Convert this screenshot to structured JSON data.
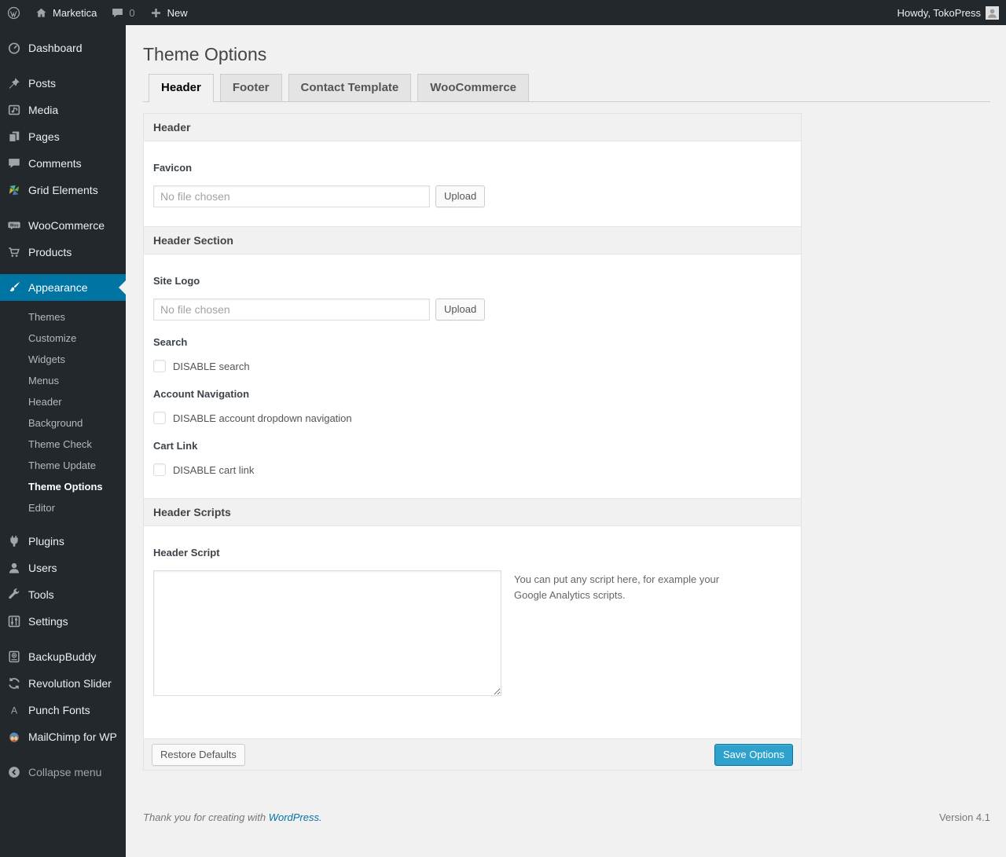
{
  "admin_bar": {
    "site_name": "Marketica",
    "comment_count": "0",
    "new_label": "New",
    "howdy": "Howdy, TokoPress"
  },
  "sidebar": {
    "items": [
      {
        "label": "Dashboard",
        "icon": "dashboard-icon"
      },
      {
        "separator": true
      },
      {
        "label": "Posts",
        "icon": "pin-icon"
      },
      {
        "label": "Media",
        "icon": "media-icon"
      },
      {
        "label": "Pages",
        "icon": "pages-icon"
      },
      {
        "label": "Comments",
        "icon": "comments-icon"
      },
      {
        "label": "Grid Elements",
        "icon": "grid-elements-icon"
      },
      {
        "separator": true
      },
      {
        "label": "WooCommerce",
        "icon": "woocommerce-icon"
      },
      {
        "label": "Products",
        "icon": "cart-icon"
      },
      {
        "separator": true
      },
      {
        "label": "Appearance",
        "icon": "appearance-icon",
        "active": true,
        "submenu": [
          {
            "label": "Themes"
          },
          {
            "label": "Customize"
          },
          {
            "label": "Widgets"
          },
          {
            "label": "Menus"
          },
          {
            "label": "Header"
          },
          {
            "label": "Background"
          },
          {
            "label": "Theme Check"
          },
          {
            "label": "Theme Update"
          },
          {
            "label": "Theme Options",
            "current": true
          },
          {
            "label": "Editor"
          }
        ]
      },
      {
        "label": "Plugins",
        "icon": "plugin-icon"
      },
      {
        "label": "Users",
        "icon": "users-icon"
      },
      {
        "label": "Tools",
        "icon": "tools-icon"
      },
      {
        "label": "Settings",
        "icon": "settings-icon"
      },
      {
        "separator": true
      },
      {
        "label": "BackupBuddy",
        "icon": "backupbuddy-icon"
      },
      {
        "label": "Revolution Slider",
        "icon": "revolution-slider-icon"
      },
      {
        "label": "Punch Fonts",
        "icon": "punch-fonts-icon"
      },
      {
        "label": "MailChimp for WP",
        "icon": "mailchimp-icon"
      },
      {
        "separator": true
      },
      {
        "label": "Collapse menu",
        "icon": "collapse-icon",
        "collapse": true
      }
    ]
  },
  "theme_options": {
    "page_title": "Theme Options",
    "tabs": [
      {
        "label": "Header",
        "active": true
      },
      {
        "label": "Footer",
        "active": false
      },
      {
        "label": "Contact Template",
        "active": false
      },
      {
        "label": "WooCommerce",
        "active": false
      }
    ],
    "sections": [
      {
        "title": "Header",
        "fields": [
          {
            "type": "file",
            "label": "Favicon",
            "value": "",
            "placeholder": "No file chosen",
            "button": "Upload"
          }
        ]
      },
      {
        "title": "Header Section",
        "fields": [
          {
            "type": "file",
            "label": "Site Logo",
            "value": "",
            "placeholder": "No file chosen",
            "button": "Upload"
          },
          {
            "type": "checkbox",
            "label": "Search",
            "checkbox_label": "DISABLE search",
            "checked": false
          },
          {
            "type": "checkbox",
            "label": "Account Navigation",
            "checkbox_label": "DISABLE account dropdown navigation",
            "checked": false
          },
          {
            "type": "checkbox",
            "label": "Cart Link",
            "checkbox_label": "DISABLE cart link",
            "checked": false
          }
        ]
      },
      {
        "title": "Header Scripts",
        "fields": [
          {
            "type": "textarea",
            "label": "Header Script",
            "value": "",
            "note": "You can put any script here, for example your Google Analytics scripts."
          }
        ]
      }
    ],
    "footer_buttons": {
      "restore": "Restore Defaults",
      "save": "Save Options"
    }
  },
  "page_footer": {
    "thanks_prefix": "Thank you for creating with ",
    "wordpress_link": "WordPress.",
    "version": "Version 4.1"
  },
  "colors": {
    "admin_dark": "#23282d",
    "menu_highlight": "#0074a2",
    "primary_button": "#2ea2cc",
    "link": "#0074a2",
    "page_background": "#f1f1f1"
  }
}
